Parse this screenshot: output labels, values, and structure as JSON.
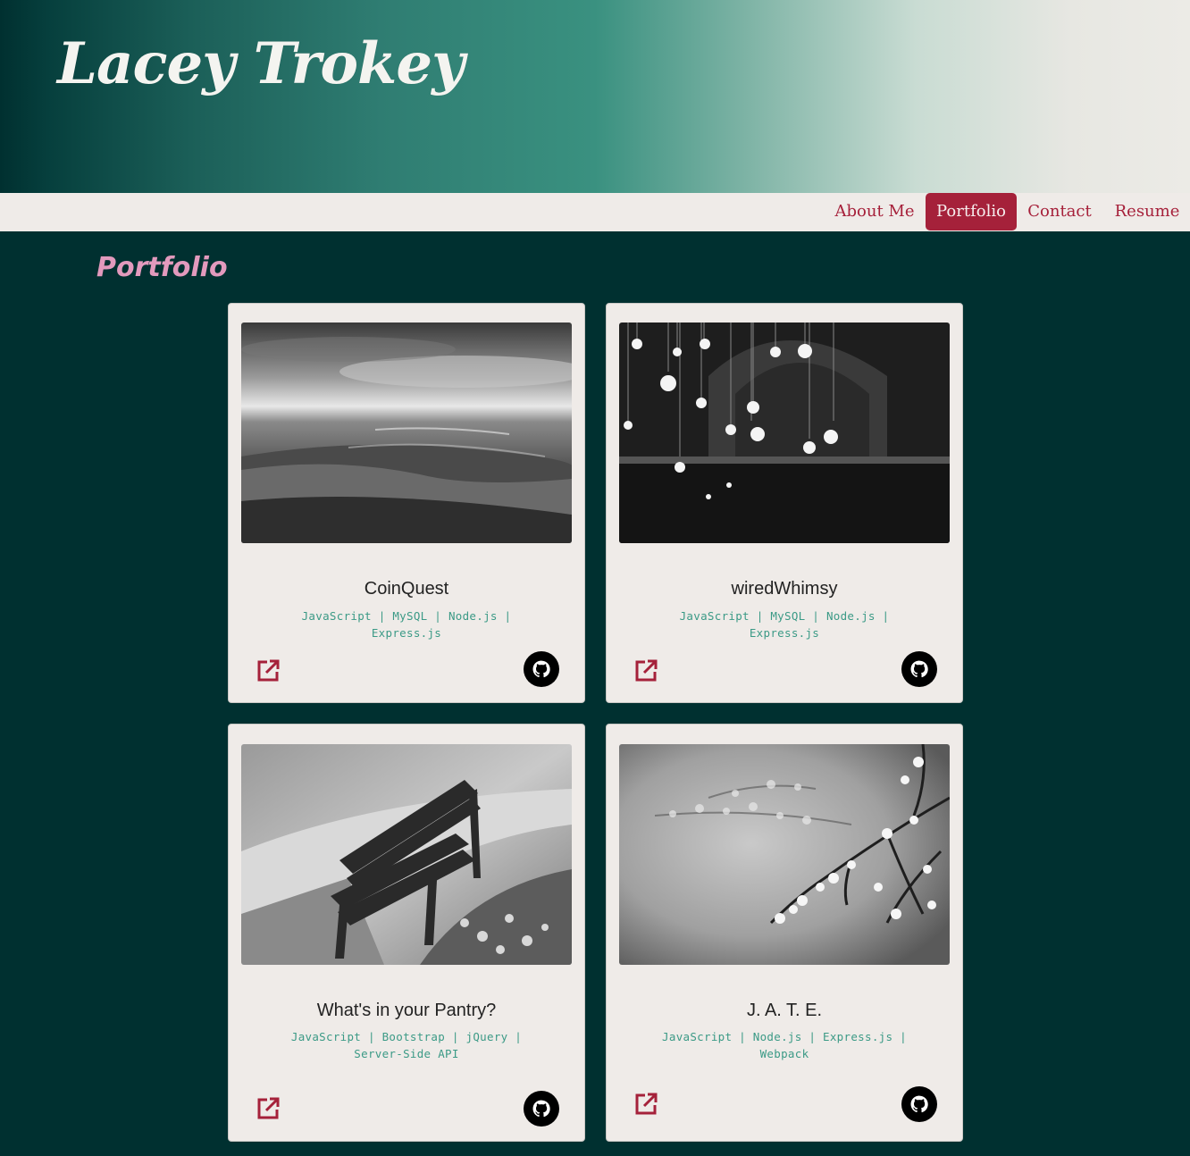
{
  "header": {
    "site_title": "Lacey Trokey"
  },
  "nav": {
    "items": [
      {
        "label": "About Me"
      },
      {
        "label": "Portfolio"
      },
      {
        "label": "Contact"
      },
      {
        "label": "Resume"
      }
    ],
    "active": "Portfolio"
  },
  "section": {
    "title": "Portfolio"
  },
  "projects": [
    {
      "title": "CoinQuest",
      "tech": "JavaScript | MySQL | Node.js | Express.js",
      "image_icon": "ocean-shore-photo"
    },
    {
      "title": "wiredWhimsy",
      "tech": "JavaScript | MySQL | Node.js | Express.js",
      "image_icon": "hanging-lights-photo"
    },
    {
      "title": "What's in your Pantry?",
      "tech": "JavaScript | Bootstrap | jQuery | Server-Side API",
      "image_icon": "park-bench-photo"
    },
    {
      "title": "J. A. T. E.",
      "tech": "JavaScript | Node.js | Express.js | Webpack",
      "image_icon": "cherry-blossom-photo"
    }
  ],
  "colors": {
    "background": "#003030",
    "accent": "#a5213a",
    "tech_text": "#3b9a86",
    "section_title": "#e29abd",
    "card": "#efebe8"
  }
}
